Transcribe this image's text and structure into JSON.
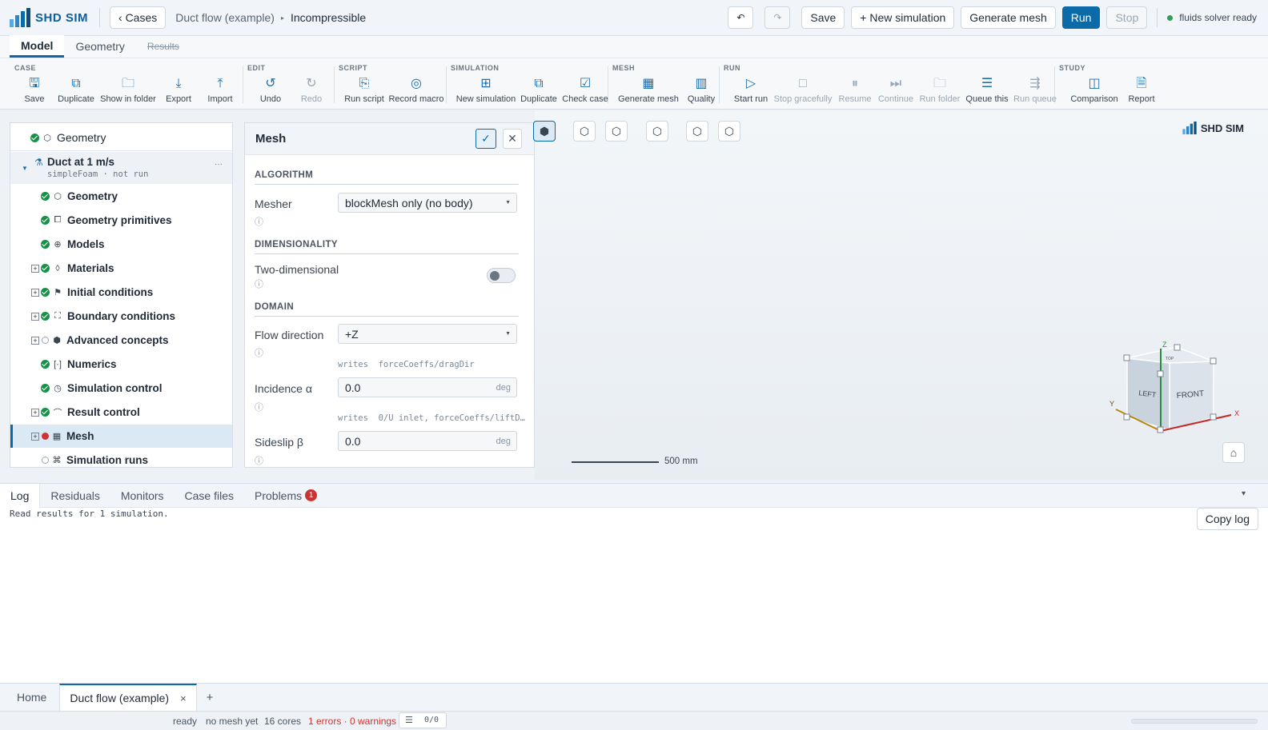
{
  "app": {
    "name": "SHD SIM",
    "brand_color": "#0b6aa8"
  },
  "topbar": {
    "back_label": "‹ Cases",
    "breadcrumb": [
      "Duct flow (example)",
      "Incompressible"
    ],
    "undo_icon": "undo-icon",
    "redo_icon": "redo-icon",
    "save_label": "Save",
    "new_sim_label": "+ New simulation",
    "generate_mesh_label": "Generate mesh",
    "run_label": "Run",
    "stop_label": "Stop",
    "status_text": "fluids solver ready"
  },
  "main_tabs": [
    {
      "label": "Model"
    },
    {
      "label": "Geometry"
    },
    {
      "label": "Results"
    }
  ],
  "ribbon": {
    "groups": {
      "case": "CASE",
      "edit": "EDIT",
      "script": "SCRIPT",
      "simulation": "SIMULATION",
      "mesh": "MESH",
      "run": "RUN",
      "study": "STUDY"
    },
    "buttons": [
      {
        "label": "Save",
        "icon": "save-icon"
      },
      {
        "label": "Duplicate",
        "icon": "duplicate-icon"
      },
      {
        "label": "Show in folder",
        "icon": "folder-icon"
      },
      {
        "label": "Export",
        "icon": "export-icon"
      },
      {
        "label": "Import",
        "icon": "import-icon"
      },
      {
        "label": "Undo",
        "icon": "undo-icon"
      },
      {
        "label": "Redo",
        "icon": "redo-icon"
      },
      {
        "label": "Run script",
        "icon": "script-icon"
      },
      {
        "label": "Record macro",
        "icon": "record-icon"
      },
      {
        "label": "New simulation",
        "icon": "plus-icon"
      },
      {
        "label": "Duplicate",
        "icon": "duplicate-icon"
      },
      {
        "label": "Check case",
        "icon": "check-case-icon"
      },
      {
        "label": "Generate mesh",
        "icon": "grid-icon"
      },
      {
        "label": "Quality",
        "icon": "bar-chart-icon"
      },
      {
        "label": "Start run",
        "icon": "play-icon"
      },
      {
        "label": "Stop gracefully",
        "icon": "stop-icon"
      },
      {
        "label": "Resume",
        "icon": "pause-icon"
      },
      {
        "label": "Continue",
        "icon": "skip-icon"
      },
      {
        "label": "Run folder",
        "icon": "folder-icon"
      },
      {
        "label": "Queue this",
        "icon": "queue-icon"
      },
      {
        "label": "Run queue",
        "icon": "run-queue-icon"
      },
      {
        "label": "Comparison",
        "icon": "comparison-icon"
      },
      {
        "label": "Report",
        "icon": "report-icon"
      }
    ]
  },
  "tree": {
    "root_label": "Geometry",
    "sim_title": "Duct at 1 m/s",
    "sim_sub": "simpleFoam · not run",
    "more": "···",
    "items": [
      {
        "label": "Geometry",
        "icon": "cube-icon"
      },
      {
        "label": "Geometry primitives",
        "icon": "primitives-icon"
      },
      {
        "label": "Models",
        "icon": "globe-icon"
      },
      {
        "label": "Materials",
        "icon": "drop-icon"
      },
      {
        "label": "Initial conditions",
        "icon": "flag-icon"
      },
      {
        "label": "Boundary conditions",
        "icon": "boundary-icon"
      },
      {
        "label": "Advanced concepts",
        "icon": "hex-icon"
      },
      {
        "label": "Numerics",
        "icon": "numerics-icon"
      },
      {
        "label": "Simulation control",
        "icon": "clock-icon"
      },
      {
        "label": "Result control",
        "icon": "gauge-icon"
      },
      {
        "label": "Mesh",
        "icon": "grid-icon"
      },
      {
        "label": "Simulation runs",
        "icon": "runs-icon"
      }
    ]
  },
  "mesh_panel": {
    "title": "Mesh",
    "algorithm_section": "ALGORITHM",
    "mesher_label": "Mesher",
    "mesher_value": "blockMesh only (no body)",
    "dimensionality_section": "DIMENSIONALITY",
    "two_d_label": "Two-dimensional",
    "domain_section": "DOMAIN",
    "flow_dir_label": "Flow direction",
    "flow_dir_value": "+Z",
    "flow_dir_hint": "writes  forceCoeffs/dragDir",
    "incidence_label": "Incidence α",
    "incidence_value": "0.0",
    "incidence_unit": "deg",
    "incidence_hint": "writes  0/U inlet, forceCoeffs/liftD…",
    "sideslip_label": "Sideslip β",
    "sideslip_value": "0.0",
    "sideslip_unit": "deg",
    "info_glyph": "ⓘ"
  },
  "viewport": {
    "brand": "SHD SIM",
    "scale_label": "500 mm",
    "triad": {
      "z": "Z",
      "y": "Y",
      "x": "X",
      "top": "TOP",
      "left": "LEFT",
      "front": "FRONT"
    }
  },
  "bottom_panel": {
    "tabs": [
      "Log",
      "Residuals",
      "Monitors",
      "Case files",
      "Problems"
    ],
    "problems_count": "1",
    "log_text": "Read results for 1 simulation.",
    "copy_log_label": "Copy log",
    "collapse_glyph": "▾"
  },
  "doc_tabs": {
    "home": "Home",
    "active": "Duct flow (example)",
    "close": "×",
    "add": "+"
  },
  "statusbar": {
    "state": "ready",
    "mesh": "no mesh yet",
    "cores": "16 cores",
    "errors": "1 errors · 0 warnings",
    "counter": "0/0"
  }
}
